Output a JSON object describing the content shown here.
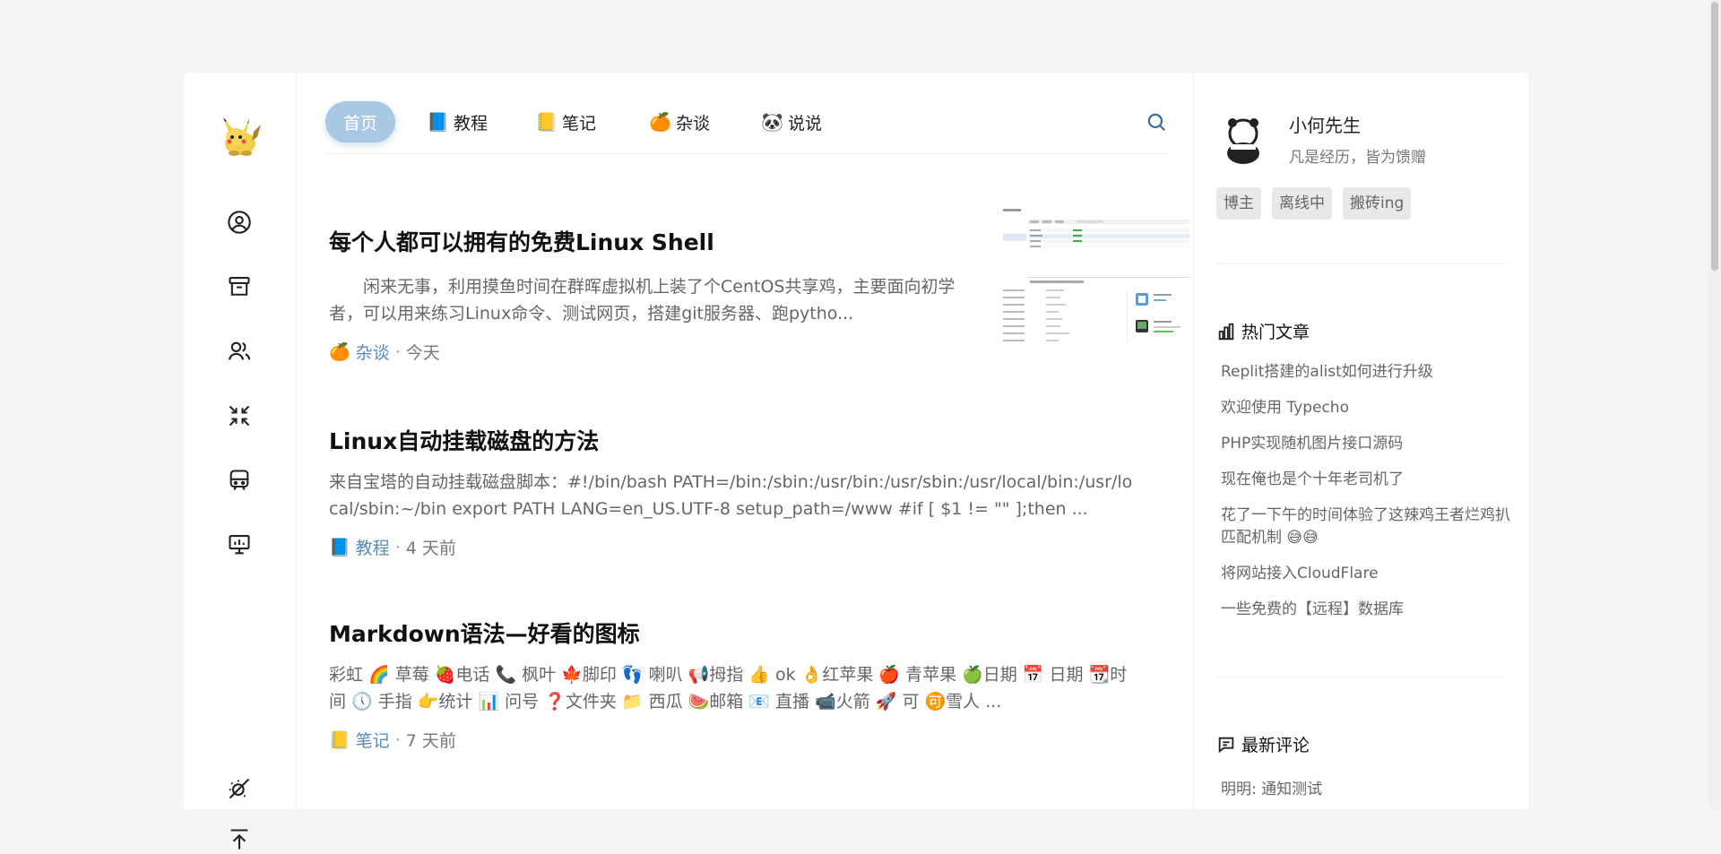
{
  "nav": {
    "items": [
      {
        "label": "首页",
        "emoji": ""
      },
      {
        "label": "教程",
        "emoji": "📘"
      },
      {
        "label": "笔记",
        "emoji": "📒"
      },
      {
        "label": "杂谈",
        "emoji": "🍊"
      },
      {
        "label": "说说",
        "emoji": "🐼"
      }
    ]
  },
  "posts": [
    {
      "title": "每个人都可以拥有的免费Linux Shell",
      "excerpt": "　　闲来无事，利用摸鱼时间在群晖虚拟机上装了个CentOS共享鸡，主要面向初学者，可以用来练习Linux命令、测试网页，搭建git服务器、跑pytho...",
      "category": "杂谈",
      "category_emoji": "🍊",
      "time": "今天"
    },
    {
      "title": "Linux自动挂载磁盘的方法",
      "excerpt": "来自宝塔的自动挂载磁盘脚本：#!/bin/bash PATH=/bin:/sbin:/usr/bin:/usr/sbin:/usr/local/bin:/usr/local/sbin:~/bin export PATH LANG=en_US.UTF-8 setup_path=/www #if [ $1 != \"\" ];then ...",
      "category": "教程",
      "category_emoji": "📘",
      "time": "4 天前"
    },
    {
      "title": "Markdown语法—好看的图标",
      "excerpt": "彩虹 🌈 草莓 🍓电话 📞 枫叶 🍁脚印 👣 喇叭 📢拇指 👍 ok 👌红苹果 🍎 青苹果 🍏日期 📅 日期 📆时间 🕔 手指 👉统计 📊 问号 ❓文件夹 📁 西瓜 🍉邮箱 📧 直播 📹火箭 🚀 可 🉑雪人 ...",
      "category": "笔记",
      "category_emoji": "📒",
      "time": "7 天前"
    }
  ],
  "author": {
    "name": "小何先生",
    "motto": "凡是经历，皆为馈赠",
    "tags": [
      "博主",
      "离线中",
      "搬砖ing"
    ]
  },
  "hot": {
    "title": "热门文章",
    "items": [
      "Replit搭建的alist如何进行升级",
      "欢迎使用 Typecho",
      "PHP实现随机图片接口源码",
      "现在俺也是个十年老司机了",
      "花了一下午的时间体验了这辣鸡王者烂鸡扒匹配机制 😅😅",
      "将网站接入CloudFlare",
      "一些免费的【远程】数据库"
    ]
  },
  "comments": {
    "title": "最新评论",
    "first": "明明: 通知测试"
  },
  "colors": {
    "accent": "#a9c8e4",
    "category_link": "#5a8bb8"
  }
}
